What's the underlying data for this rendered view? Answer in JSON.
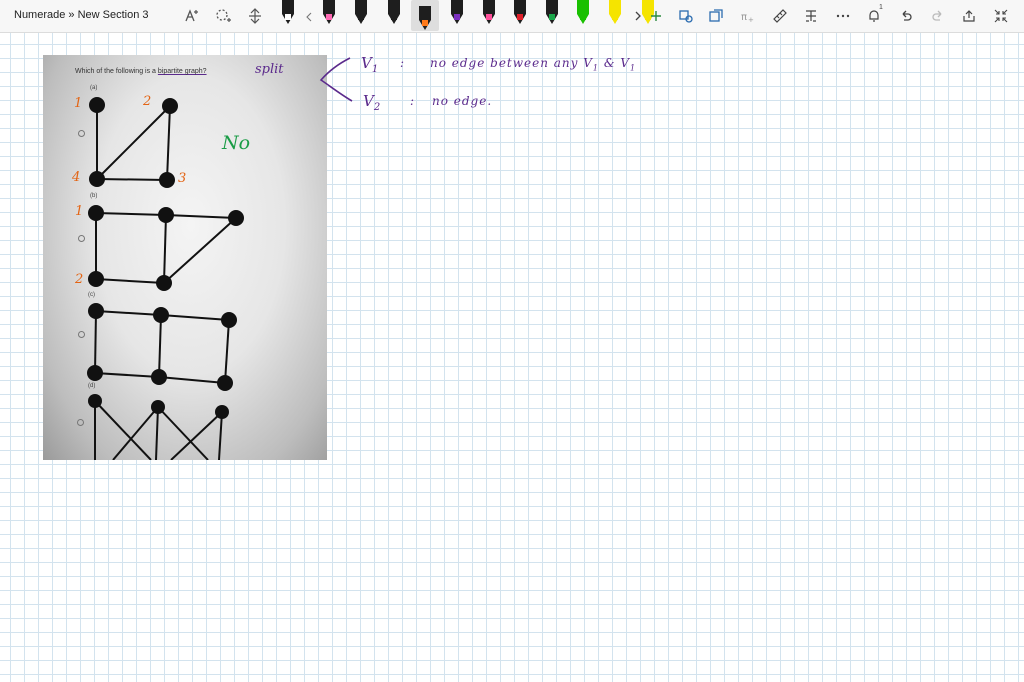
{
  "app": {
    "breadcrumb": "Numerade » New Section 3"
  },
  "toolbar": {
    "tools": [
      "lasso-select-icon",
      "add-space-icon",
      "expand-vertical-icon"
    ],
    "pens": [
      {
        "color": "#1e1e1e",
        "tip": "#ffffff"
      },
      {
        "color": "#1e1e1e",
        "tip": "#ff69b4"
      },
      {
        "color": "#1e1e1e",
        "tip": "#1e1e1e"
      },
      {
        "color": "#1e1e1e",
        "tip": "#1e1e1e"
      },
      {
        "color": "#1e1e1e",
        "tip": "#ff7a1a",
        "selected": true
      },
      {
        "color": "#1e1e1e",
        "tip": "#7b2fbf"
      },
      {
        "color": "#1e1e1e",
        "tip": "#ff4f9a"
      },
      {
        "color": "#1e1e1e",
        "tip": "#e0202a"
      },
      {
        "color": "#1e1e1e",
        "tip": "#1aa64a"
      },
      {
        "color": "#19c000",
        "tip": "#19c000"
      },
      {
        "color": "#f5e400",
        "tip": "#f5e400"
      },
      {
        "color": "#f5e400",
        "tip": "#f5e400"
      },
      {
        "color": "#12c0e8",
        "tip": "#12c0e8"
      }
    ],
    "right_icons": [
      "lasso-shape-icon",
      "ink-to-shape-icon",
      "ink-to-math-icon",
      "ruler-icon",
      "ink-to-text-icon",
      "more-icon",
      "notification-icon",
      "undo-icon",
      "redo-icon",
      "share-icon",
      "fullscreen-icon"
    ],
    "notification_count": "1"
  },
  "photo": {
    "question_prefix": "Which of the following is a ",
    "question_underlined": "bipartite graph?",
    "parts": [
      "(a)",
      "(b)",
      "(c)",
      "(d)"
    ]
  },
  "annotations": {
    "node_labels_a": [
      "1",
      "2",
      "4",
      "3"
    ],
    "node_labels_b": [
      "1",
      "2"
    ],
    "verdict": "No",
    "split_word": "split",
    "v1": {
      "name": "V",
      "sub": "1",
      "colon": ":",
      "text": "no edge between any V",
      "sub2": "1",
      "text2": "& V",
      "sub3": "1"
    },
    "v2": {
      "name": "V",
      "sub": "2",
      "colon": ":",
      "text": "no edge."
    }
  },
  "colors": {
    "orange": "#e36414",
    "purple": "#5b2a8c",
    "green": "#1a9c46",
    "grid": "#d3e3ee"
  }
}
